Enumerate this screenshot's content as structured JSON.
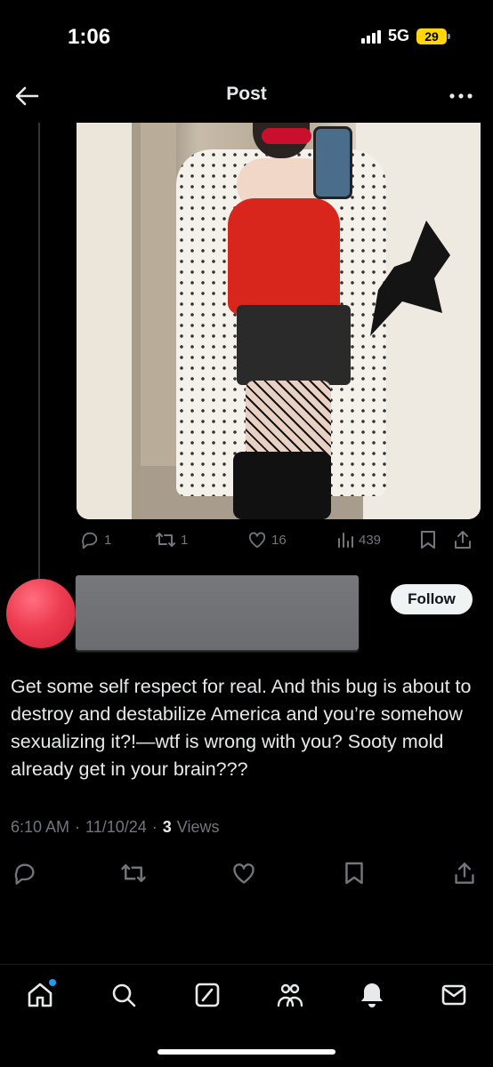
{
  "status_bar": {
    "time": "1:06",
    "network": "5G",
    "battery": "29"
  },
  "header": {
    "title": "Post",
    "back_icon": "arrow-left-icon",
    "more_icon": "more-horizontal-icon"
  },
  "post": {
    "image_alt": "photo",
    "stats": {
      "replies": "1",
      "reposts": "1",
      "likes": "16",
      "views": "439"
    }
  },
  "reply": {
    "avatar_color": "#ee3b50",
    "follow_label": "Follow",
    "text": "Get some self respect for real. And this bug is about to destroy and destabilize America and you’re somehow sexualizing it?!—wtf is wrong with you? Sooty mold already get in your brain???",
    "time": "6:10 AM",
    "date": "11/10/24",
    "separator": "·",
    "views_count": "3",
    "views_label": "Views"
  },
  "colors": {
    "background": "#000000",
    "text": "#e7e9ea",
    "muted": "#71767b",
    "accent": "#1d9bf0"
  },
  "nav": {
    "items": [
      "home-icon",
      "search-icon",
      "grok-icon",
      "communities-icon",
      "notifications-icon",
      "messages-icon"
    ]
  }
}
